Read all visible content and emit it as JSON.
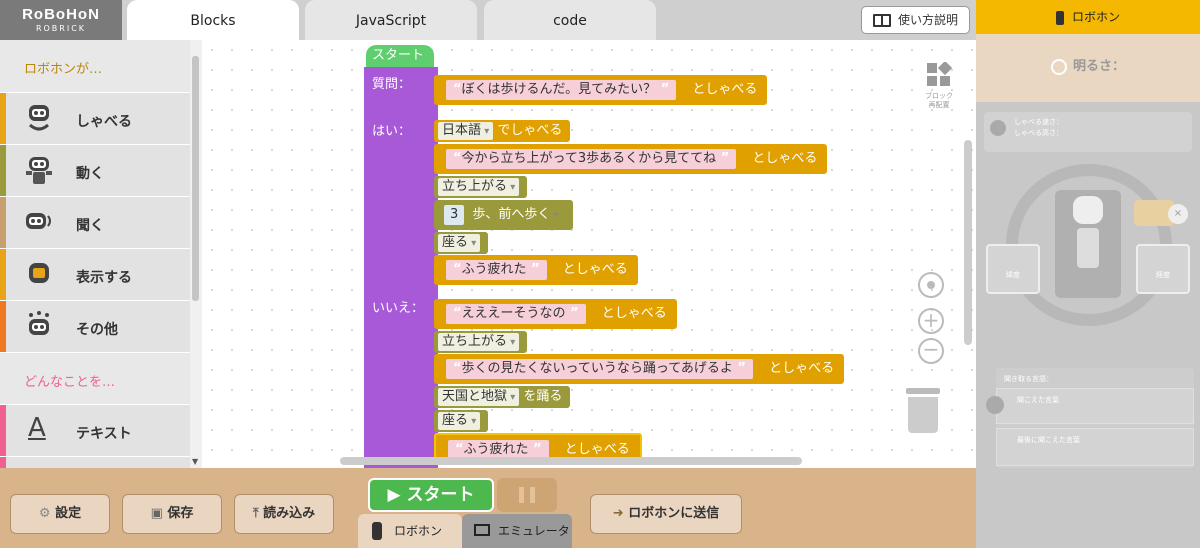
{
  "logo": {
    "name": "RoBoHoN",
    "sub": "ROBRICK"
  },
  "tabs": [
    {
      "label": "Blocks"
    },
    {
      "label": "JavaScript"
    },
    {
      "label": "code"
    }
  ],
  "help_label": "使い方説明",
  "sidebar": {
    "section1": "ロボホンが…",
    "items": [
      {
        "label": "しゃべる",
        "color": "#e8a317"
      },
      {
        "label": "動く",
        "color": "#9a9a3c"
      },
      {
        "label": "聞く",
        "color": "#c8a070"
      },
      {
        "label": "表示する",
        "color": "#e8a317"
      },
      {
        "label": "その他",
        "color": "#f07820"
      }
    ],
    "section2": "どんなことを…",
    "items2": [
      {
        "label": "テキスト",
        "color": "#f06090",
        "glyph": "A"
      }
    ]
  },
  "workspace": {
    "start": "スタート",
    "labels": {
      "question": "質問：",
      "yes": "はい：",
      "no": "いいえ："
    },
    "q_text": "ぼくは歩けるんだ。見てみたい？",
    "say_suffix": "としゃべる",
    "lang": "日本語",
    "lang_suffix": "でしゃべる",
    "yes_line1": "今から立ち上がって3歩あるくから見ててね",
    "stand": "立ち上がる",
    "steps_num": "3",
    "steps_label": "歩、前へ歩く",
    "sit": "座る",
    "tired": "ふう疲れた",
    "no_line1": "えええーそうなの",
    "no_line2": "歩くの見たくないっていうなら踊ってあげるよ",
    "dance": "天国と地獄",
    "dance_suffix": "を踊る",
    "tool_label": "ブロック\n再配置"
  },
  "bottom": {
    "settings": "設定",
    "save": "保存",
    "load": "読み込み",
    "play": "▶ スタート",
    "mode_robo": "ロボホン",
    "mode_emu": "エミュレータ",
    "send": "ロボホンに送信"
  },
  "right_panel": {
    "header": "ロボホン",
    "brightness": "明るさ：",
    "speak_speed": "しゃべる速さ：",
    "speak_pitch": "しゃべる高さ：",
    "latitude": "緯度",
    "longitude": "経度",
    "heard_title": "聞き取る言語：",
    "heard_words": "聞こえた言葉",
    "last_heard": "最後に聞こえた言葉"
  }
}
